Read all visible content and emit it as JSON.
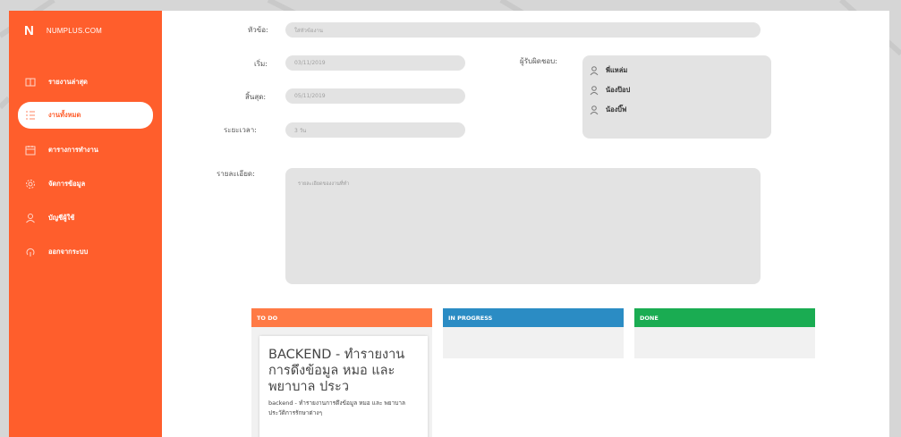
{
  "brand": {
    "logo": "N",
    "name": "NUMPLUS.COM"
  },
  "sidebar": {
    "items": [
      {
        "label": "รายงานล่าสุด",
        "icon": "book-icon",
        "active": false
      },
      {
        "label": "งานทั้งหมด",
        "icon": "list-icon",
        "active": true
      },
      {
        "label": "ตารางการทำงาน",
        "icon": "calendar-icon",
        "active": false
      },
      {
        "label": "จัดการข้อมูล",
        "icon": "gear-icon",
        "active": false
      },
      {
        "label": "บัญชีผู้ใช้",
        "icon": "user-icon",
        "active": false
      },
      {
        "label": "ออกจากระบบ",
        "icon": "logout-icon",
        "active": false
      }
    ]
  },
  "form": {
    "title_label": "หัวข้อ:",
    "title_value": "ใส่หัวข้องาน",
    "start_label": "เริ่ม:",
    "start_value": "03/11/2019",
    "end_label": "สิ้นสุด:",
    "end_value": "05/11/2019",
    "duration_label": "ระยะเวลา:",
    "duration_value": "3 วัน",
    "assignee_label": "ผู้รับผิดชอบ:",
    "assignees": [
      "พี่แหล่ม",
      "น้องป๊อป",
      "น้องบิ๊ฟ"
    ],
    "detail_label": "รายละเอียด:",
    "detail_placeholder": "รายละเอียดของงานที่ทำ"
  },
  "board": {
    "columns": [
      {
        "label": "TO DO",
        "color": "#ff7a45"
      },
      {
        "label": "IN PROGRESS",
        "color": "#2b8cc4"
      },
      {
        "label": "DONE",
        "color": "#1aac52"
      }
    ],
    "card": {
      "title": "BACKEND - ทำรายงาน การดึงข้อมูล หมอ และ พยาบาล ประว",
      "desc": "backend - ทำรายงานการดึงข้อมูล หมอ และ พยาบาล ประวัติการรักษาต่างๆ"
    }
  },
  "colors": {
    "accent": "#ff5e2c"
  }
}
